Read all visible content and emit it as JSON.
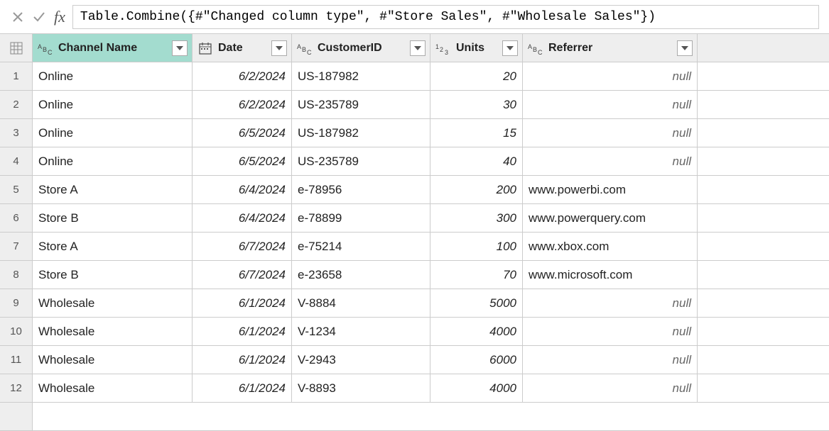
{
  "formula_bar": {
    "fx_label": "fx",
    "formula": "Table.Combine({#\"Changed column type\", #\"Store Sales\", #\"Wholesale Sales\"})"
  },
  "columns": {
    "channel": {
      "name": "Channel Name",
      "type_label": "ABC"
    },
    "date": {
      "name": "Date",
      "type_label": "date"
    },
    "customer": {
      "name": "CustomerID",
      "type_label": "ABC"
    },
    "units": {
      "name": "Units",
      "type_label": "123"
    },
    "referrer": {
      "name": "Referrer",
      "type_label": "ABC"
    }
  },
  "null_text": "null",
  "rows": [
    {
      "n": "1",
      "channel": "Online",
      "date": "6/2/2024",
      "customer": "US-187982",
      "units": "20",
      "referrer": null
    },
    {
      "n": "2",
      "channel": "Online",
      "date": "6/2/2024",
      "customer": "US-235789",
      "units": "30",
      "referrer": null
    },
    {
      "n": "3",
      "channel": "Online",
      "date": "6/5/2024",
      "customer": "US-187982",
      "units": "15",
      "referrer": null
    },
    {
      "n": "4",
      "channel": "Online",
      "date": "6/5/2024",
      "customer": "US-235789",
      "units": "40",
      "referrer": null
    },
    {
      "n": "5",
      "channel": "Store A",
      "date": "6/4/2024",
      "customer": "e-78956",
      "units": "200",
      "referrer": "www.powerbi.com"
    },
    {
      "n": "6",
      "channel": "Store B",
      "date": "6/4/2024",
      "customer": "e-78899",
      "units": "300",
      "referrer": "www.powerquery.com"
    },
    {
      "n": "7",
      "channel": "Store A",
      "date": "6/7/2024",
      "customer": "e-75214",
      "units": "100",
      "referrer": "www.xbox.com"
    },
    {
      "n": "8",
      "channel": "Store B",
      "date": "6/7/2024",
      "customer": "e-23658",
      "units": "70",
      "referrer": "www.microsoft.com"
    },
    {
      "n": "9",
      "channel": "Wholesale",
      "date": "6/1/2024",
      "customer": "V-8884",
      "units": "5000",
      "referrer": null
    },
    {
      "n": "10",
      "channel": "Wholesale",
      "date": "6/1/2024",
      "customer": "V-1234",
      "units": "4000",
      "referrer": null
    },
    {
      "n": "11",
      "channel": "Wholesale",
      "date": "6/1/2024",
      "customer": "V-2943",
      "units": "6000",
      "referrer": null
    },
    {
      "n": "12",
      "channel": "Wholesale",
      "date": "6/1/2024",
      "customer": "V-8893",
      "units": "4000",
      "referrer": null
    }
  ]
}
